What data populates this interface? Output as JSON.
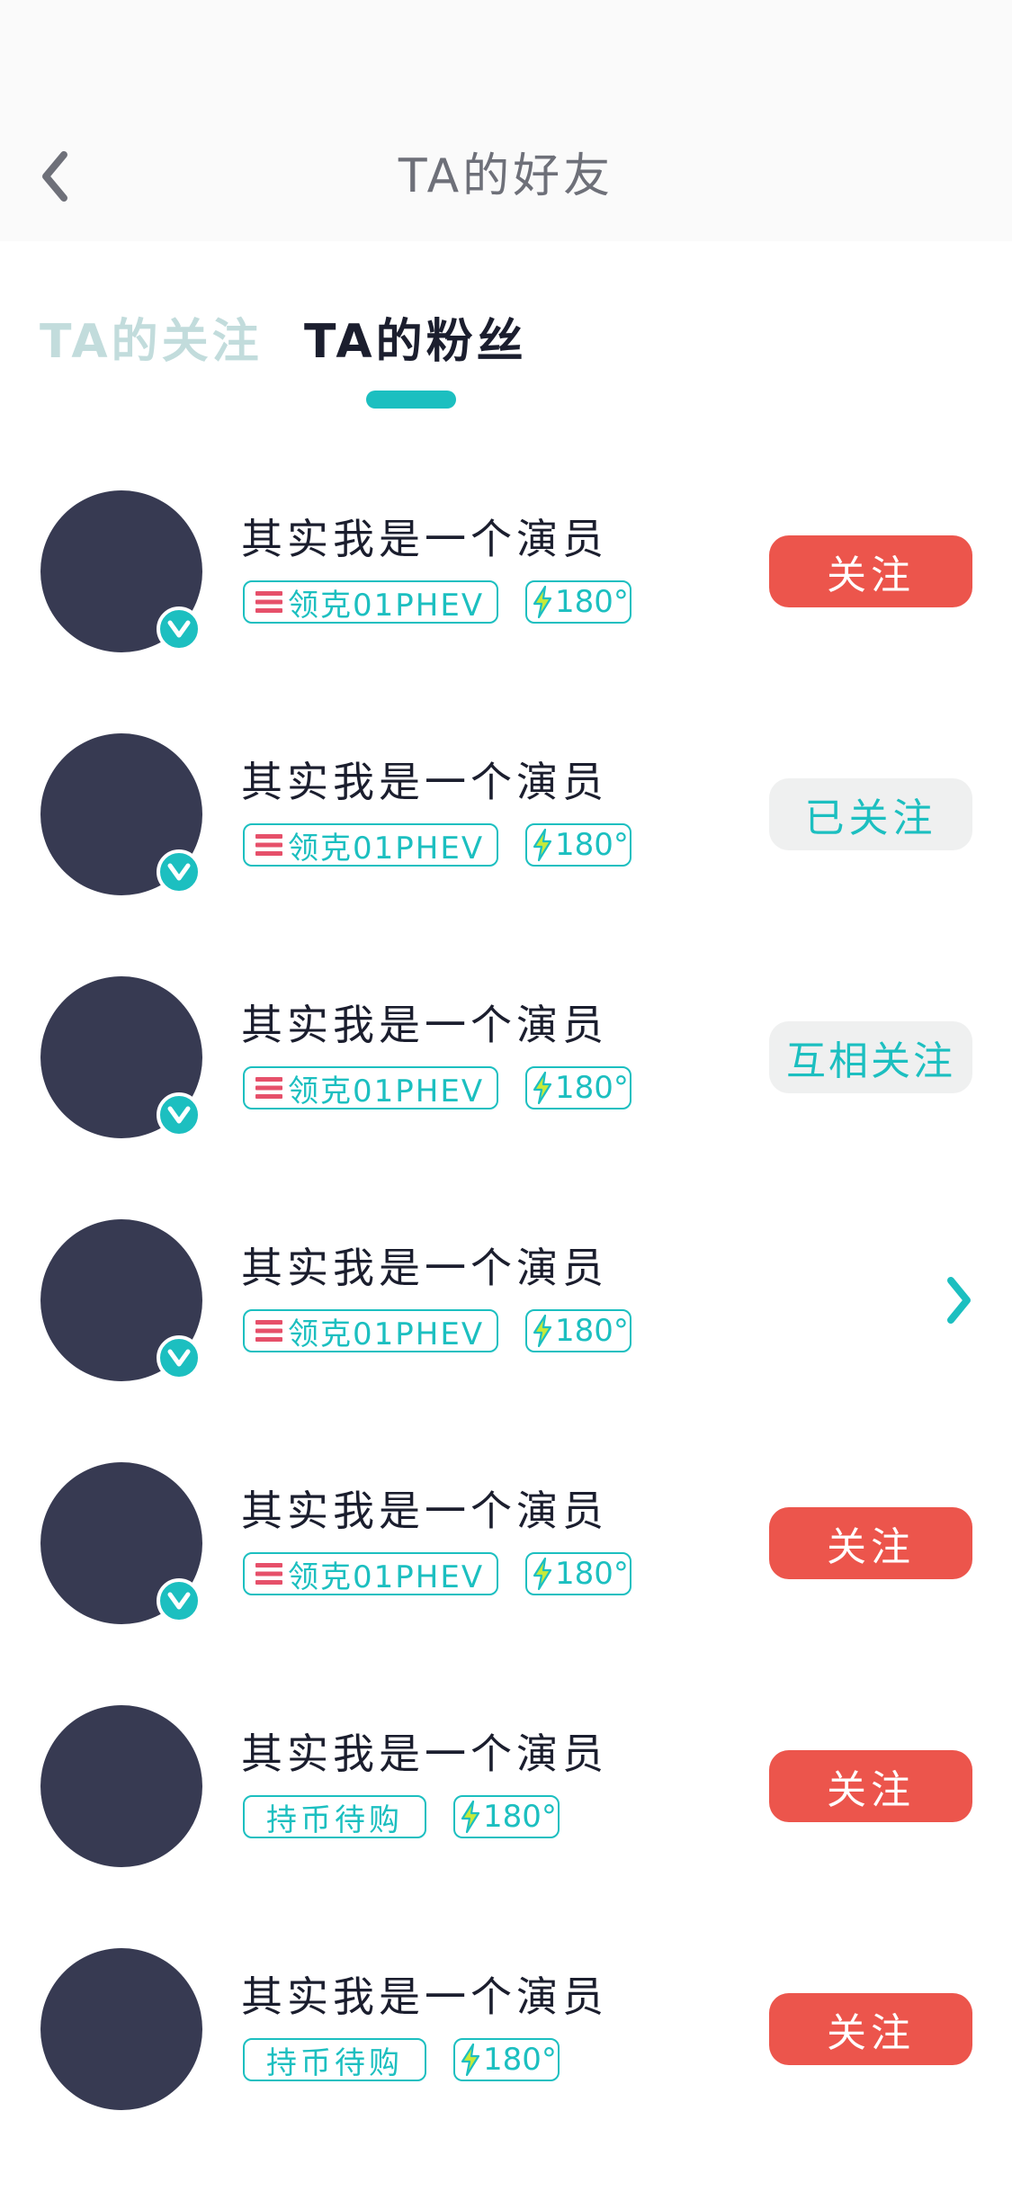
{
  "header": {
    "title": "TA的好友"
  },
  "tabs": [
    {
      "label": "TA的关注",
      "active": false
    },
    {
      "label": "TA的粉丝",
      "active": true
    }
  ],
  "colors": {
    "accent": "#1cbfc0",
    "follow_button": "#ec554c",
    "avatar": "#373a52",
    "car_menu_icon": "#e6506a",
    "bolt_fill": "#c6ea3a"
  },
  "users": [
    {
      "name": "其实我是一个演员",
      "verified": true,
      "tag": "领克01PHEV",
      "tag_type": "car",
      "energy": "180°",
      "action": "follow",
      "action_label": "关注"
    },
    {
      "name": "其实我是一个演员",
      "verified": true,
      "tag": "领克01PHEV",
      "tag_type": "car",
      "energy": "180°",
      "action": "followed",
      "action_label": "已关注"
    },
    {
      "name": "其实我是一个演员",
      "verified": true,
      "tag": "领克01PHEV",
      "tag_type": "car",
      "energy": "180°",
      "action": "mutual",
      "action_label": "互相关注"
    },
    {
      "name": "其实我是一个演员",
      "verified": true,
      "tag": "领克01PHEV",
      "tag_type": "car",
      "energy": "180°",
      "action": "chevron",
      "action_label": ""
    },
    {
      "name": "其实我是一个演员",
      "verified": true,
      "tag": "领克01PHEV",
      "tag_type": "car",
      "energy": "180°",
      "action": "follow",
      "action_label": "关注"
    },
    {
      "name": "其实我是一个演员",
      "verified": false,
      "tag": "持币待购",
      "tag_type": "coin",
      "energy": "180°",
      "action": "follow",
      "action_label": "关注"
    },
    {
      "name": "其实我是一个演员",
      "verified": false,
      "tag": "持币待购",
      "tag_type": "coin",
      "energy": "180°",
      "action": "follow",
      "action_label": "关注"
    }
  ]
}
